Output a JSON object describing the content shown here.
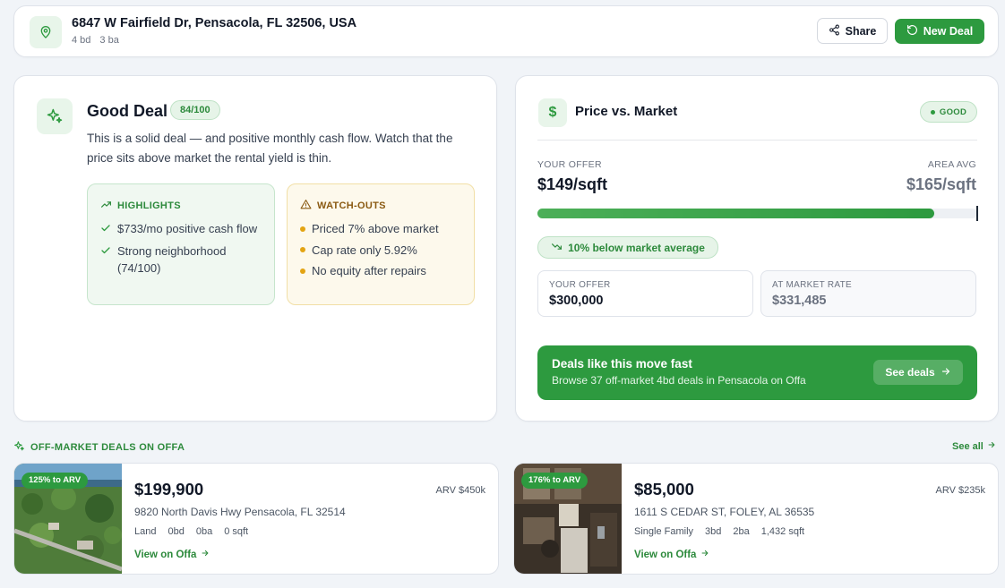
{
  "header": {
    "address": "6847 W Fairfield Dr, Pensacola, FL 32506, USA",
    "beds": "4 bd",
    "baths": "3 ba",
    "share_label": "Share",
    "new_deal_label": "New Deal"
  },
  "deal": {
    "title": "Good Deal",
    "score": "84/100",
    "description": "This is a solid deal — and positive monthly cash flow. Watch that the price sits above market the rental yield is thin.",
    "highlights_title": "HIGHLIGHTS",
    "highlights": [
      "$733/mo positive cash flow",
      "Strong neighborhood (74/100)"
    ],
    "watchouts_title": "WATCH-OUTS",
    "watchouts": [
      "Priced 7% above market",
      "Cap rate only 5.92%",
      "No equity after repairs"
    ]
  },
  "price_market": {
    "title": "Price vs. Market",
    "status": "GOOD",
    "your_offer_label": "YOUR OFFER",
    "your_offer_psf": "$149/sqft",
    "area_avg_label": "AREA AVG",
    "area_avg_psf": "$165/sqft",
    "bar_fill_fraction": 0.903,
    "below_market_text": "10% below market average",
    "offer_box_label": "YOUR OFFER",
    "offer_box_value": "$300,000",
    "market_box_label": "AT MARKET RATE",
    "market_box_value": "$331,485",
    "promo_title": "Deals like this move fast",
    "promo_sub": "Browse 37 off-market 4bd deals in Pensacola on Offa",
    "promo_button": "See deals"
  },
  "offmarket": {
    "title": "OFF-MARKET DEALS ON OFFA",
    "see_all": "See all",
    "listings": [
      {
        "badge": "125% to ARV",
        "price": "$199,900",
        "arv": "ARV $450k",
        "address": "9820 North Davis Hwy Pensacola, FL 32514",
        "type": "Land",
        "bd": "0bd",
        "ba": "0ba",
        "sqft": "0 sqft",
        "view": "View on Offa"
      },
      {
        "badge": "176% to ARV",
        "price": "$85,000",
        "arv": "ARV $235k",
        "address": "1611 S CEDAR ST, FOLEY, AL 36535",
        "type": "Single Family",
        "bd": "3bd",
        "ba": "2ba",
        "sqft": "1,432 sqft",
        "view": "View on Offa"
      }
    ]
  },
  "colors": {
    "accent": "#2d9a3f",
    "accent_text": "#2d8a3c",
    "warning": "#e3a413",
    "background": "#f1f4f8"
  },
  "icons": {
    "header": "map-pin-icon",
    "share": "share-icon",
    "new_deal": "refresh-icon",
    "deal": "sparkles-icon",
    "highlights": "trending-up-icon",
    "watchouts": "alert-triangle-icon",
    "price": "dollar-icon",
    "below": "trending-down-icon",
    "arrow": "arrow-right-icon"
  }
}
